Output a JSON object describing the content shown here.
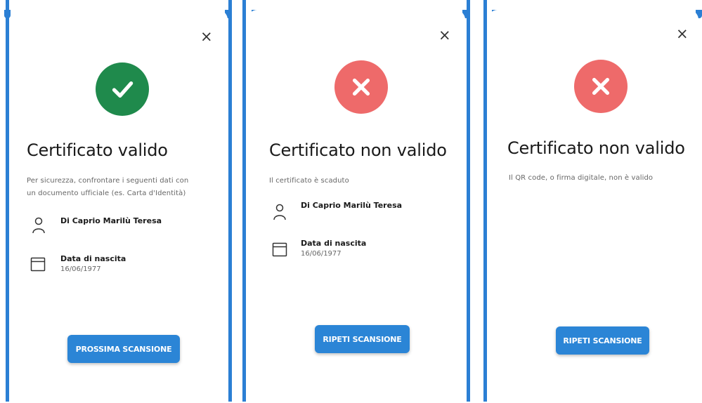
{
  "screens": [
    {
      "close_symbol": "×",
      "status_icon": "check-icon",
      "status_color": "#1f8a4c",
      "title": "Certificato valido",
      "description_line1": "Per sicurezza, confrontare i seguenti dati con",
      "description_line2": "un documento ufficiale (es. Carta d'Identità)",
      "holder_name": "Di Caprio Marilù Teresa",
      "birth_label": "Data di nascita",
      "birth_date": "16/06/1977",
      "button_label": "PROSSIMA SCANSIONE"
    },
    {
      "close_symbol": "×",
      "status_icon": "cross-icon",
      "status_color": "#ee6a6a",
      "title": "Certificato non valido",
      "description_line1": "Il certificato è scaduto",
      "holder_name": "Di Caprio Marilù Teresa",
      "birth_label": "Data di nascita",
      "birth_date": "16/06/1977",
      "button_label": "RIPETI SCANSIONE"
    },
    {
      "close_symbol": "×",
      "status_icon": "cross-icon",
      "status_color": "#ee6a6a",
      "title": "Certificato non valido",
      "description_line1": "Il QR code, o firma digitale, non è valido",
      "button_label": "RIPETI SCANSIONE"
    }
  ],
  "colors": {
    "accent_blue": "#2b85d6",
    "valid_green": "#1f8a4c",
    "invalid_red": "#ee6a6a"
  }
}
